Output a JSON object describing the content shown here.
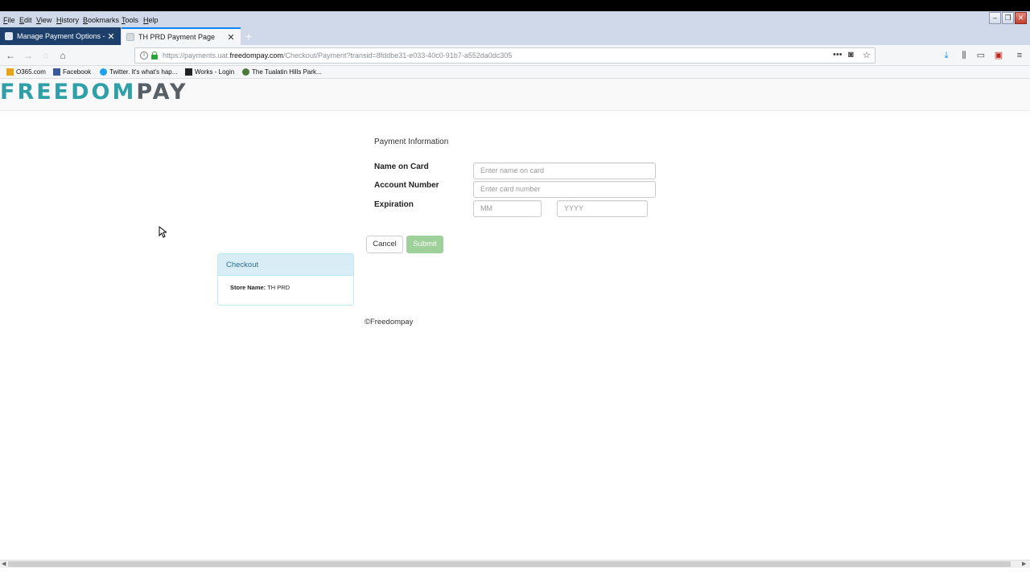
{
  "menu": {
    "items": [
      {
        "label": "File",
        "accel": "F",
        "rest": "ile"
      },
      {
        "label": "Edit",
        "accel": "E",
        "rest": "dit"
      },
      {
        "label": "View",
        "accel": "V",
        "rest": "iew"
      },
      {
        "label": "History",
        "accel": "H",
        "rest": "istory"
      },
      {
        "label": "Bookmarks",
        "accel": "B",
        "rest": "ookmarks"
      },
      {
        "label": "Tools",
        "accel": "T",
        "rest": "ools"
      },
      {
        "label": "Help",
        "accel": "H",
        "rest": "elp"
      }
    ]
  },
  "tabs": [
    {
      "label": "Manage Payment Options - A",
      "active": false
    },
    {
      "label": "TH PRD Payment Page",
      "active": true
    }
  ],
  "urlbar": {
    "prefix": "https://payments.uat.",
    "domain": "freedompay.com",
    "suffix": "/Checkout/Payment?transid=8fddbe31-e033-40c0-91b7-a552da0dc305"
  },
  "bookmarks": [
    {
      "label": "O365.com",
      "color": "#e8a317"
    },
    {
      "label": "Facebook",
      "color": "#3b5998"
    },
    {
      "label": "Twitter. It's what's hap...",
      "color": "#1da1f2"
    },
    {
      "label": "Works - Login",
      "color": "#222222"
    },
    {
      "label": "The Tualatin Hills Park...",
      "color": "#4a7a3a"
    }
  ],
  "brand": {
    "freedom": "FREEDOM",
    "pay": "PAY"
  },
  "form": {
    "title": "Payment Information",
    "name_label": "Name on Card",
    "name_placeholder": "Enter name on card",
    "account_label": "Account Number",
    "account_placeholder": "Enter card number",
    "expiration_label": "Expiration",
    "month_placeholder": "MM",
    "year_placeholder": "YYYY",
    "cancel_label": "Cancel",
    "submit_label": "Submit"
  },
  "checkout": {
    "title": "Checkout",
    "store_label": "Store Name:",
    "store_value": "TH PRD"
  },
  "footer": {
    "copyright": "©Freedompay"
  },
  "colors": {
    "accent": "#0a84ff",
    "brand_teal": "#2f9fa8",
    "submit_green": "#9ed09a",
    "panel_head": "#d9edf7"
  }
}
